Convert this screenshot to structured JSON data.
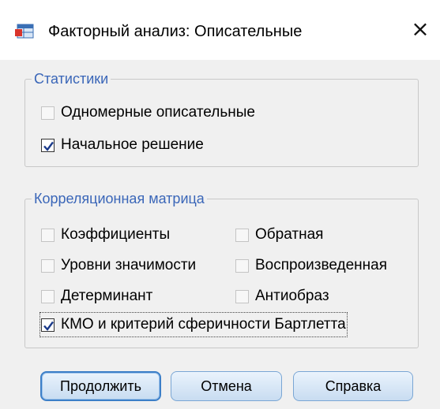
{
  "window": {
    "title": "Факторный анализ: Описательные",
    "close_glyph": "×",
    "app_icon": "spss-table-icon"
  },
  "statistics": {
    "legend": "Статистики",
    "items": [
      {
        "label": "Одномерные описательные",
        "checked": false
      },
      {
        "label": "Начальное решение",
        "checked": true
      }
    ]
  },
  "correlation_matrix": {
    "legend": "Корреляционная матрица",
    "items": [
      {
        "label": "Коэффициенты",
        "checked": false
      },
      {
        "label": "Обратная",
        "checked": false
      },
      {
        "label": "Уровни значимости",
        "checked": false
      },
      {
        "label": "Воспроизведенная",
        "checked": false
      },
      {
        "label": "Детерминант",
        "checked": false
      },
      {
        "label": "Антиобраз",
        "checked": false
      },
      {
        "label": "КМО и критерий сферичности Бартлетта",
        "checked": true
      }
    ]
  },
  "buttons": {
    "continue": "Продолжить",
    "cancel": "Отмена",
    "help": "Справка"
  },
  "colors": {
    "legend_text": "#3a66b8",
    "button_border": "#7aa6d4",
    "checkmark": "#1a3a8a"
  }
}
